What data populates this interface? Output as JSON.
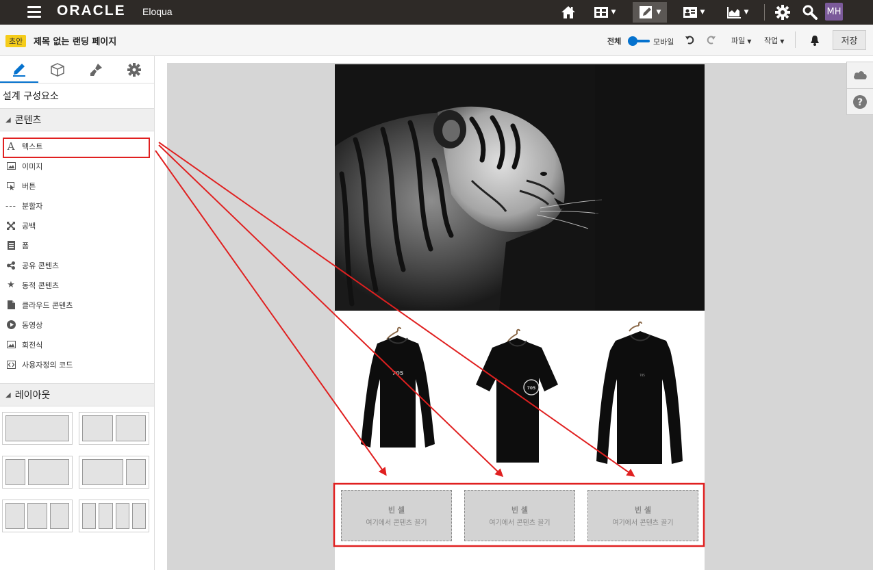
{
  "topbar": {
    "brand": "ORACLE",
    "app": "Eloqua",
    "nav_icons": [
      "home-icon",
      "dashboard-icon",
      "design-icon",
      "contacts-icon",
      "analytics-icon",
      "settings-icon",
      "search-icon"
    ],
    "avatar_initials": "MH"
  },
  "subbar": {
    "status_badge": "초안",
    "page_title": "제목 없는 랜딩 페이지",
    "view_full": "전체",
    "view_mobile": "모바일",
    "file_menu": "파일",
    "action_menu": "작업",
    "save_label": "저장"
  },
  "sidebar": {
    "section_title": "설계 구성요소",
    "content_group": "콘텐츠",
    "items": [
      {
        "label": "텍스트",
        "icon": "text-icon"
      },
      {
        "label": "이미지",
        "icon": "image-icon"
      },
      {
        "label": "버튼",
        "icon": "button-icon"
      },
      {
        "label": "분할자",
        "icon": "divider-icon"
      },
      {
        "label": "공백",
        "icon": "spacer-icon"
      },
      {
        "label": "폼",
        "icon": "form-icon"
      },
      {
        "label": "공유 콘텐츠",
        "icon": "share-icon"
      },
      {
        "label": "동적 콘텐츠",
        "icon": "star-icon"
      },
      {
        "label": "클라우드 콘텐츠",
        "icon": "cloud-file-icon"
      },
      {
        "label": "동영상",
        "icon": "play-icon"
      },
      {
        "label": "회전식",
        "icon": "carousel-icon"
      },
      {
        "label": "사용자정의 코드",
        "icon": "code-icon"
      }
    ],
    "layout_group": "레이아웃"
  },
  "canvas": {
    "cells": [
      {
        "title": "빈 셀",
        "hint": "여기에서 콘텐츠 끌기"
      },
      {
        "title": "빈 셀",
        "hint": "여기에서 콘텐츠 끌기"
      },
      {
        "title": "빈 셀",
        "hint": "여기에서 콘텐츠 끌기"
      }
    ],
    "shirt_print_1": "705",
    "shirt_print_2": "705",
    "shirt_print_3": "705"
  },
  "colors": {
    "topbar": "#2e2a27",
    "accent": "#0572ce",
    "annotation": "#e02020",
    "badge": "#f5cc1a"
  }
}
